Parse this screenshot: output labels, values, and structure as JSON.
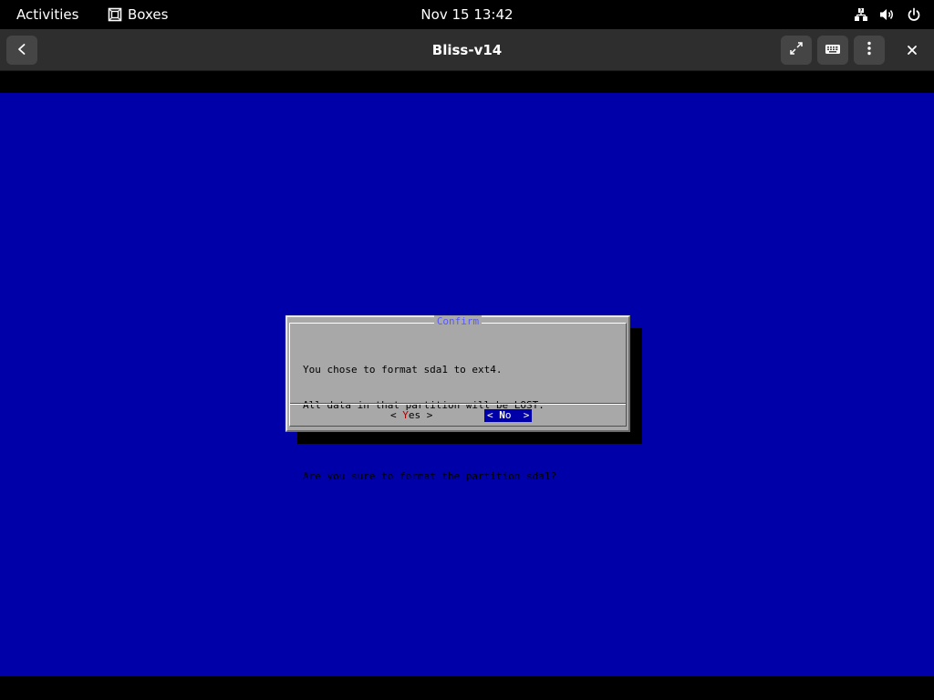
{
  "topbar": {
    "activities_label": "Activities",
    "app_label": "Boxes",
    "clock": "Nov 15  13:42",
    "icons": [
      "network-unknown-icon",
      "volume-icon",
      "power-icon"
    ]
  },
  "headerbar": {
    "title": "Bliss-v14",
    "buttons": [
      "back-icon",
      "fullscreen-icon",
      "keyboard-icon",
      "menu-dots-icon",
      "close-icon"
    ]
  },
  "vm": {
    "background_color": "#0000a8",
    "dialog": {
      "title": "Confirm",
      "lines": [
        "You chose to format sda1 to ext4.",
        "All data in that partition will be LOST.",
        "Are you sure to format the partition sda1?"
      ],
      "yes_open": "< ",
      "yes_hotkey": "Y",
      "yes_rest": "es >",
      "no_open": "< ",
      "no_hotkey": "N",
      "no_rest": "o  >",
      "selected_button": "No"
    }
  },
  "colors": {
    "topbar_bg": "#000000",
    "headerbar_bg": "#2e2e2e",
    "vm_blue": "#0000a8",
    "dialog_gray": "#a8a8a8",
    "hotkey_red": "#a80000",
    "title_blue": "#5858fc"
  }
}
